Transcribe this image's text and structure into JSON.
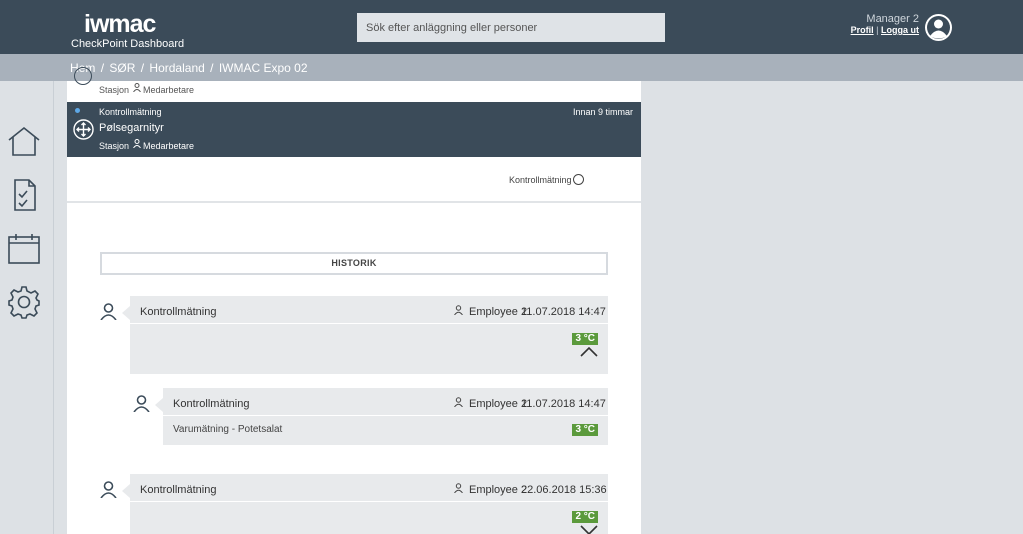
{
  "header": {
    "logo_text": "iwmac",
    "app_name": "CheckPoint Dashboard",
    "search_placeholder": "Sök efter anläggning eller personer",
    "user_name": "Manager 2",
    "profile_link": "Profil",
    "separator": "|",
    "logout_link": "Logga ut"
  },
  "breadcrumb": {
    "items": [
      "Hem",
      "SØR",
      "Hordaland",
      "IWMAC Expo 02"
    ],
    "divider": "/"
  },
  "sidebar": {
    "items": [
      {
        "icon": "home-icon"
      },
      {
        "icon": "report-icon"
      },
      {
        "icon": "calendar-icon"
      },
      {
        "icon": "settings-icon"
      }
    ]
  },
  "list": {
    "first_row": {
      "station": "Stasjon",
      "staff": "Medarbetare"
    },
    "active_row": {
      "type": "Kontrollmätning",
      "time": "Innan 9 timmar",
      "name": "Pølsegarnityr",
      "station": "Stasjon",
      "staff": "Medarbetare"
    }
  },
  "detail": {
    "kontroll_label": "Kontrollmätning",
    "historik_label": "HISTORIK"
  },
  "history": [
    {
      "title": "Kontrollmätning",
      "employee": "Employee 2",
      "datetime": "11.07.2018 14:47",
      "badge": "3 °C",
      "trend": "up"
    },
    {
      "title": "Kontrollmätning",
      "employee": "Employee 2",
      "datetime": "11.07.2018 14:47",
      "body": "Varumätning - Potetsalat",
      "badge": "3 °C"
    },
    {
      "title": "Kontrollmätning",
      "employee": "Employee 2",
      "datetime": "22.06.2018 15:36",
      "badge": "2 °C",
      "trend": "down"
    }
  ],
  "colors": {
    "header_bg": "#3b4b59",
    "breadcrumb_bg": "#a8b1bb",
    "badge_green": "#5b9a3c",
    "card_bg": "#e8eaec"
  }
}
